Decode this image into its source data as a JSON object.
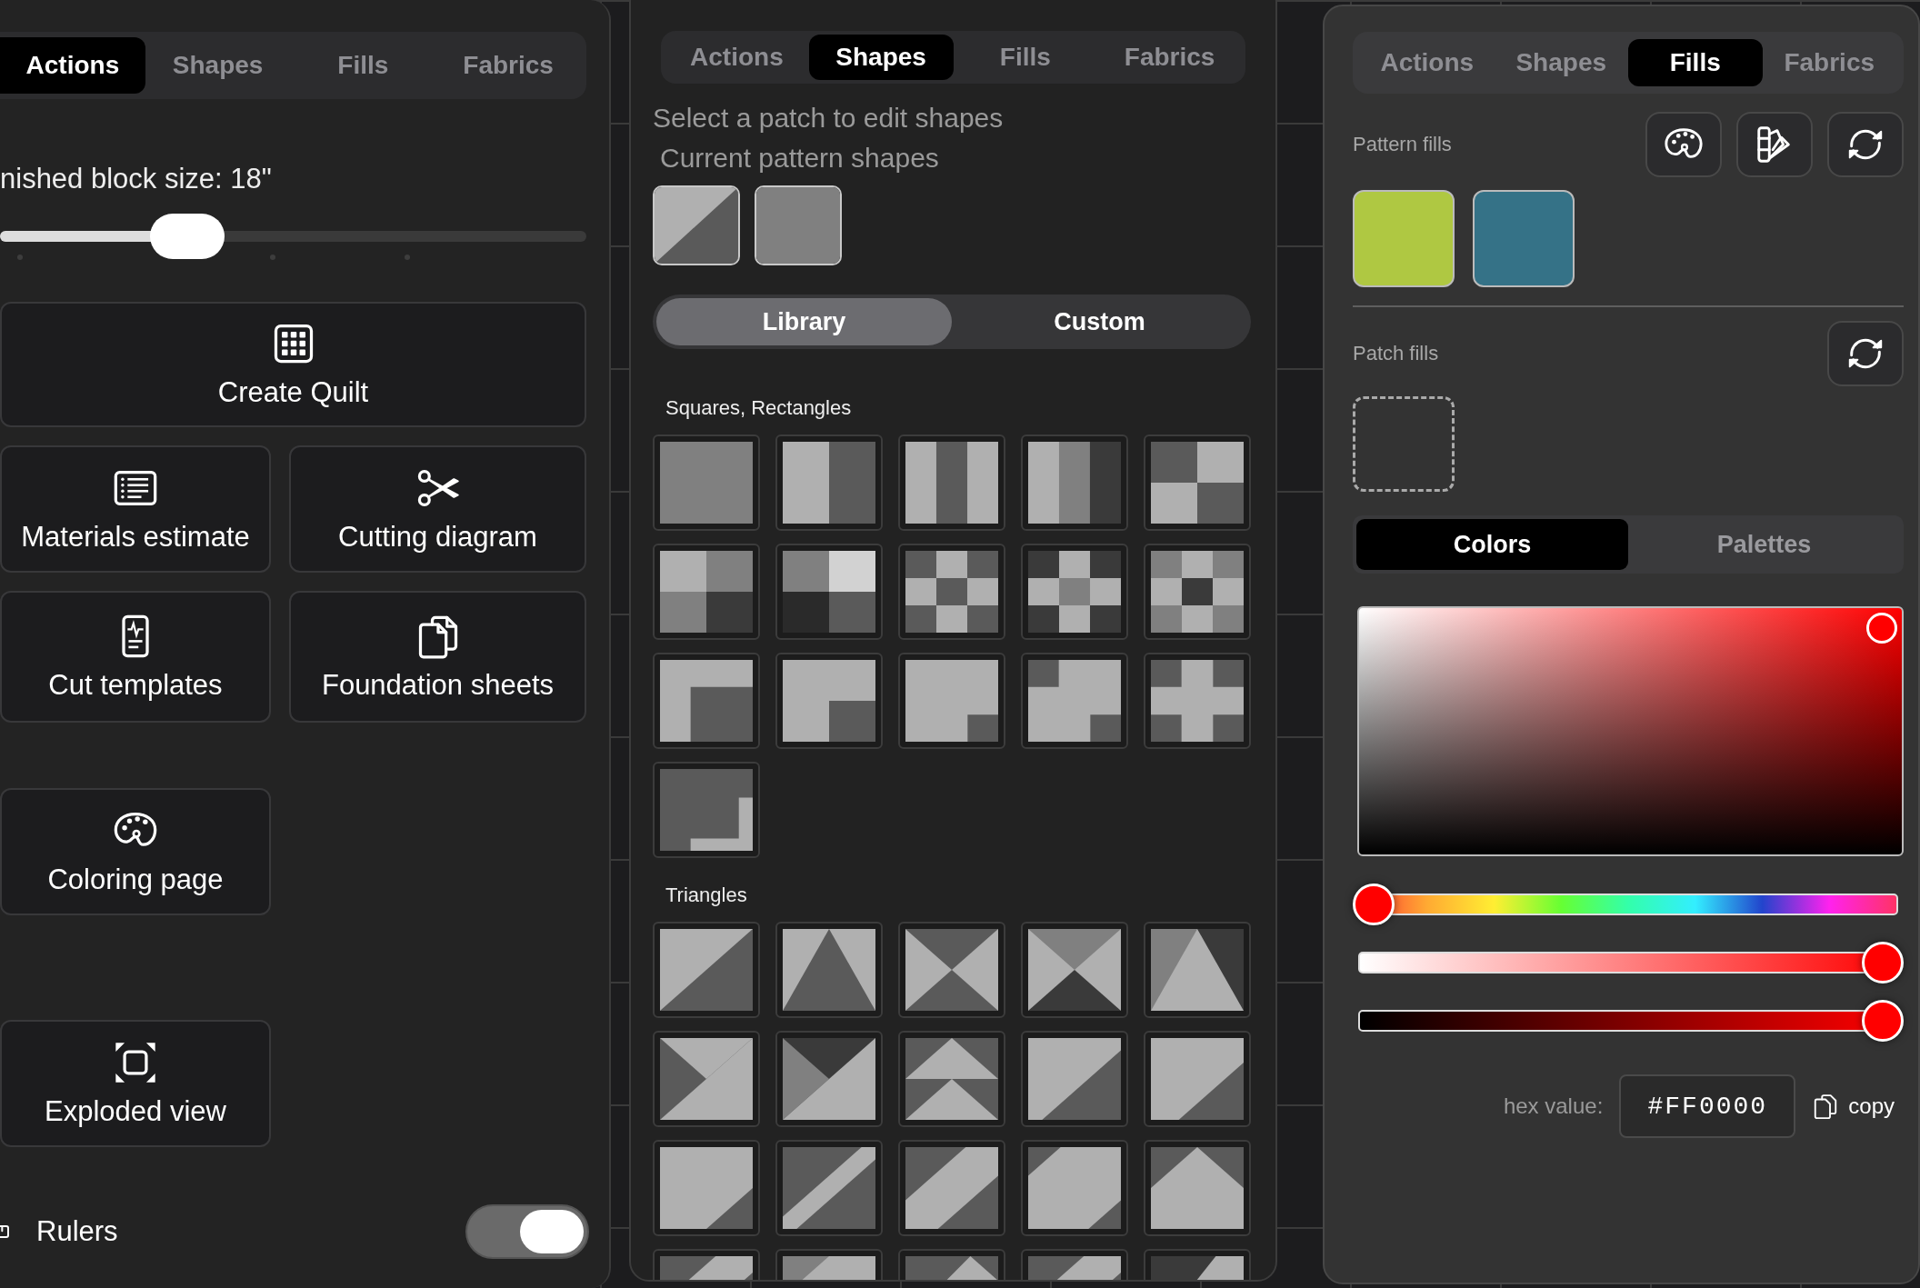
{
  "actions_panel": {
    "tabs": [
      {
        "label": "Actions",
        "selected": true
      },
      {
        "label": "Shapes",
        "selected": false
      },
      {
        "label": "Fills",
        "selected": false
      },
      {
        "label": "Fabrics",
        "selected": false
      }
    ],
    "block_size": {
      "label": "nished block size: 18\"",
      "level": 0.32
    },
    "buttons": [
      {
        "label": "Create Quilt"
      },
      {
        "label": "Materials estimate"
      },
      {
        "label": "Cutting diagram"
      },
      {
        "label": "Cut templates"
      },
      {
        "label": "Foundation sheets"
      },
      {
        "label": "Coloring page"
      },
      {
        "label": "Exploded view"
      }
    ],
    "rulers": {
      "label": "Rulers",
      "on": true
    }
  },
  "shapes_panel": {
    "tabs": [
      {
        "label": "Actions",
        "selected": false
      },
      {
        "label": "Shapes",
        "selected": true
      },
      {
        "label": "Fills",
        "selected": false
      },
      {
        "label": "Fabrics",
        "selected": false
      }
    ],
    "hint": "Select a patch to edit shapes",
    "current_label": "Current pattern shapes",
    "segments": [
      {
        "label": "Library",
        "selected": true
      },
      {
        "label": "Custom",
        "selected": false
      }
    ],
    "sections": [
      {
        "title": "Squares, Rectangles"
      },
      {
        "title": "Triangles"
      }
    ]
  },
  "fills_panel": {
    "tabs": [
      {
        "label": "Actions",
        "selected": false
      },
      {
        "label": "Shapes",
        "selected": false
      },
      {
        "label": "Fills",
        "selected": true
      },
      {
        "label": "Fabrics",
        "selected": false
      }
    ],
    "pattern_fills": {
      "label": "Pattern fills",
      "swatches": [
        {
          "color": "#afc842"
        },
        {
          "color": "#357287"
        }
      ]
    },
    "patch_fills": {
      "label": "Patch fills"
    },
    "segments": [
      {
        "label": "Colors",
        "selected": true
      },
      {
        "label": "Palettes",
        "selected": false
      }
    ],
    "picker": {
      "hue": {
        "level": 0
      },
      "saturation": {
        "level": 1
      },
      "brightness": {
        "level": 1
      }
    },
    "hex": {
      "label": "hex value:",
      "value": "#FF0000",
      "action": "copy"
    }
  }
}
